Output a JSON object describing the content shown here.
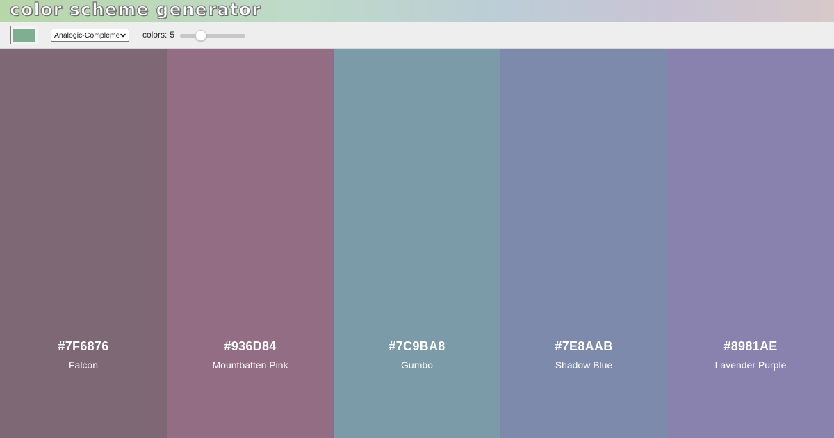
{
  "header": {
    "title": "color scheme generator",
    "gradient": [
      "#b7d6a9",
      "#bfdac9",
      "#bccdd6",
      "#c9c4d5",
      "#d7c9c9"
    ]
  },
  "toolbar": {
    "base_color": "#7fae91",
    "mode": {
      "selected": "Analogic-Complement",
      "icon": "chevron-down-icon"
    },
    "count_label": "colors:",
    "count_value": "5",
    "slider_value": 5
  },
  "palette": [
    {
      "hex": "#7F6876",
      "name": "Falcon",
      "color": "#7f6876"
    },
    {
      "hex": "#936D84",
      "name": "Mountbatten Pink",
      "color": "#936d84"
    },
    {
      "hex": "#7C9BA8",
      "name": "Gumbo",
      "color": "#7c9ba8"
    },
    {
      "hex": "#7E8AAB",
      "name": "Shadow Blue",
      "color": "#7e8aab"
    },
    {
      "hex": "#8981AE",
      "name": "Lavender Purple",
      "color": "#8981ae"
    }
  ]
}
